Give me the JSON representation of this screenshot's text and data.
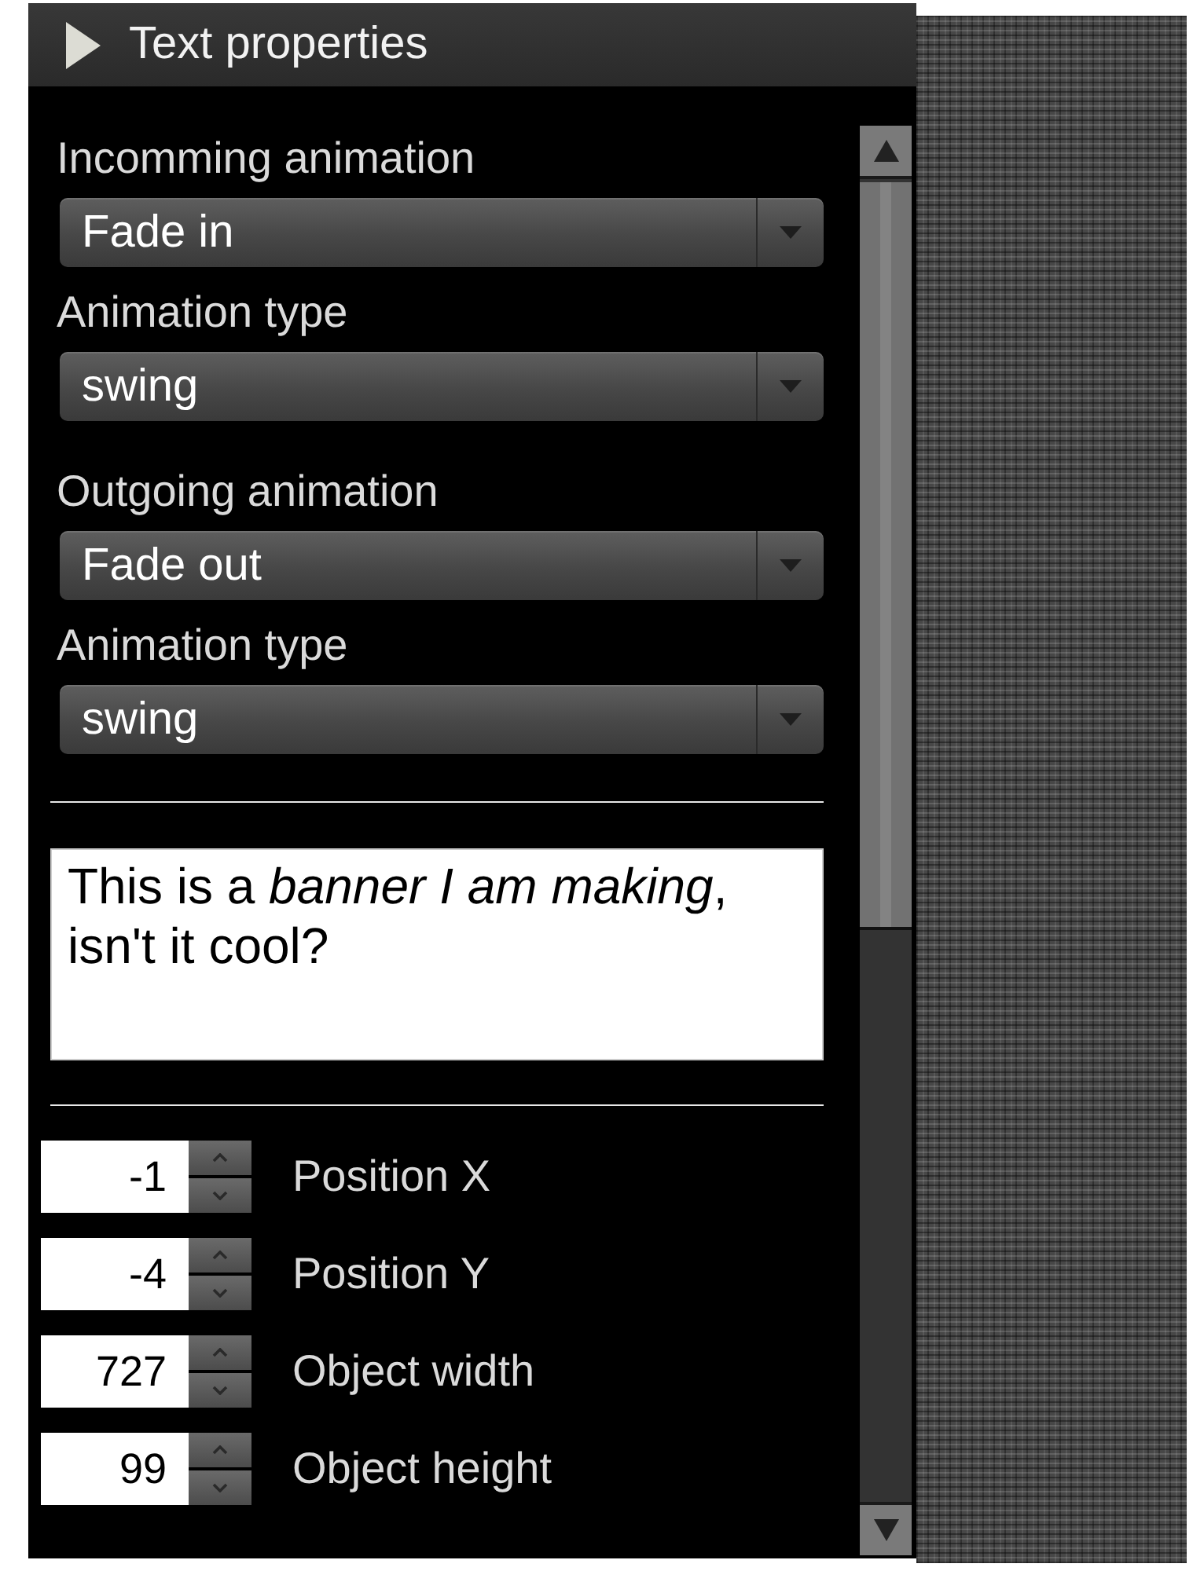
{
  "panel": {
    "title": "Text properties"
  },
  "animation_groups": [
    {
      "fields": [
        {
          "label": "Incomming animation",
          "value": "Fade in"
        },
        {
          "label": "Animation type",
          "value": "swing"
        }
      ]
    },
    {
      "fields": [
        {
          "label": "Outgoing animation",
          "value": "Fade out"
        },
        {
          "label": "Animation type",
          "value": "swing"
        }
      ]
    }
  ],
  "text_editor": {
    "value": "This is a *banner I am making*, isn't it cool?"
  },
  "number_fields": [
    {
      "value": "-1",
      "label": "Position X"
    },
    {
      "value": "-4",
      "label": "Position Y"
    },
    {
      "value": "727",
      "label": "Object width"
    },
    {
      "value": "99",
      "label": "Object height"
    }
  ]
}
